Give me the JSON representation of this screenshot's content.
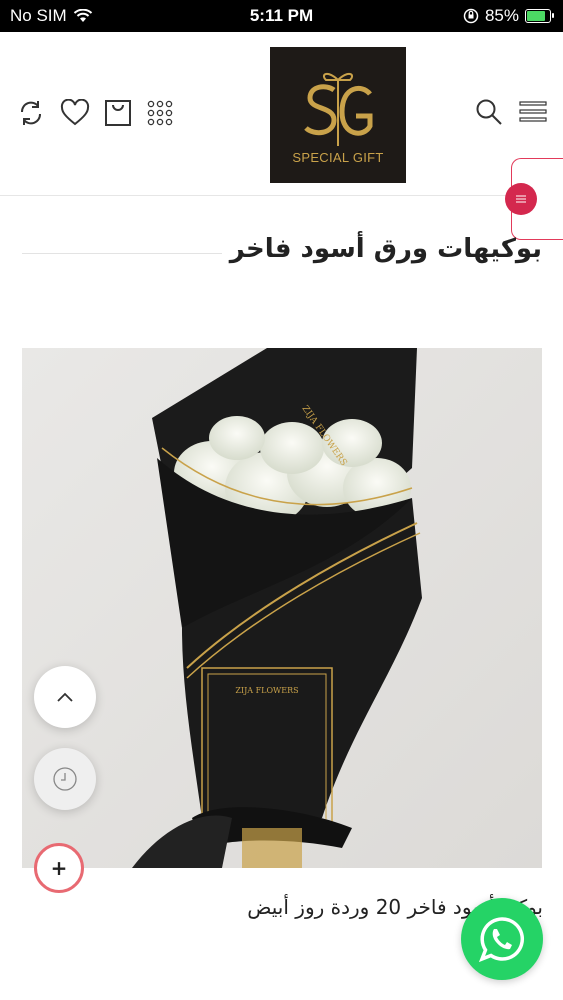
{
  "status_bar": {
    "carrier": "No SIM",
    "time": "5:11 PM",
    "battery": "85%",
    "battery_level": 0.85
  },
  "header": {
    "logo_monogram": "SG",
    "logo_text": "SPECIAL GIFT",
    "left_icons": [
      "refresh-icon",
      "heart-icon",
      "bag-icon",
      "grid-icon"
    ],
    "right_icons": [
      "search-icon",
      "menu-icon"
    ]
  },
  "section": {
    "title": "بوكيهات ورق أسود فاخر"
  },
  "product": {
    "name": "بوكيه أسود فاخر 20 وردة روز أبيض",
    "image_wrap_label": "ZIJA FLOWERS",
    "image_wrap_label_2": "ZIJA FLOWERS"
  },
  "floating": {
    "plus_label": "+",
    "icons": [
      "chevron-up-icon",
      "clock-icon",
      "whatsapp-icon"
    ]
  },
  "colors": {
    "accent": "#d4284e",
    "logo_bg": "#1e1a17",
    "logo_gold": "#c9a24a",
    "whatsapp": "#25d366"
  }
}
